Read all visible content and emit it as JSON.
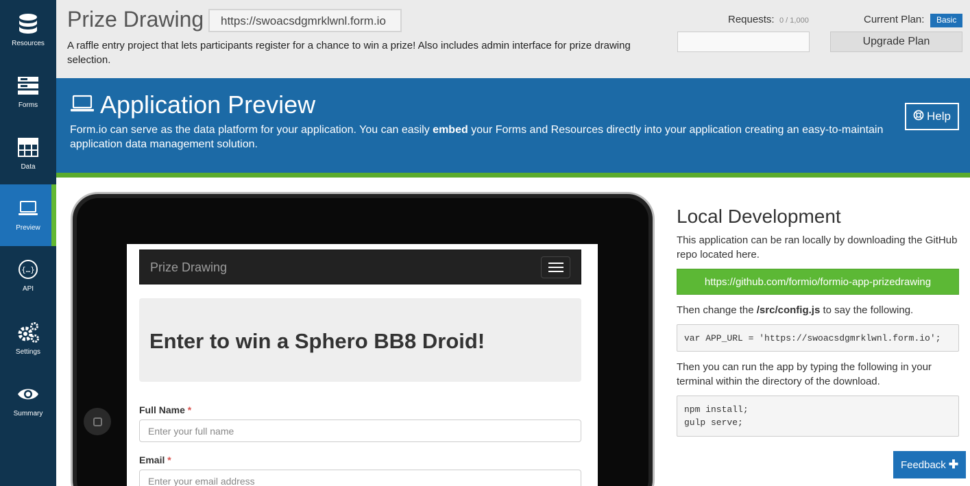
{
  "sidebar": {
    "items": [
      {
        "label": "Resources",
        "icon": "database-icon"
      },
      {
        "label": "Forms",
        "icon": "forms-icon"
      },
      {
        "label": "Data",
        "icon": "table-icon"
      },
      {
        "label": "Preview",
        "icon": "laptop-icon",
        "active": true
      },
      {
        "label": "API",
        "icon": "api-icon"
      },
      {
        "label": "Settings",
        "icon": "gears-icon"
      },
      {
        "label": "Summary",
        "icon": "eye-icon"
      }
    ]
  },
  "header": {
    "title": "Prize Drawing",
    "url": "https://swoacsdgmrklwnl.form.io",
    "description": "A raffle entry project that lets participants register for a chance to win a prize! Also includes admin interface for prize drawing selection.",
    "requests_label": "Requests:",
    "requests_count": "0 / 1,000",
    "plan_label": "Current Plan:",
    "plan_name": "Basic",
    "upgrade_label": "Upgrade Plan"
  },
  "banner": {
    "title": "Application Preview",
    "text_before": "Form.io can serve as the data platform for your application. You can easily ",
    "text_bold": "embed",
    "text_after": " your Forms and Resources directly into your application creating an easy-to-maintain application data management solution.",
    "help_label": "Help"
  },
  "preview": {
    "brand": "Prize Drawing",
    "heading": "Enter to win a Sphero BB8 Droid!",
    "fields": [
      {
        "label": "Full Name",
        "required_mark": "*",
        "placeholder": "Enter your full name"
      },
      {
        "label": "Email",
        "required_mark": "*",
        "placeholder": "Enter your email address"
      }
    ]
  },
  "local_dev": {
    "title": "Local Development",
    "intro": "This application can be ran locally by downloading the GitHub repo located here.",
    "repo_link": "https://github.com/formio/formio-app-prizedrawing",
    "config_before": "Then change the ",
    "config_file": "/src/config.js",
    "config_after": " to say the following.",
    "config_code": "var APP_URL = 'https://swoacsdgmrklwnl.form.io';",
    "run_text": "Then you can run the app by typing the following in your terminal within the directory of the download.",
    "run_code": "npm install;\ngulp serve;"
  },
  "feedback_label": "Feedback"
}
